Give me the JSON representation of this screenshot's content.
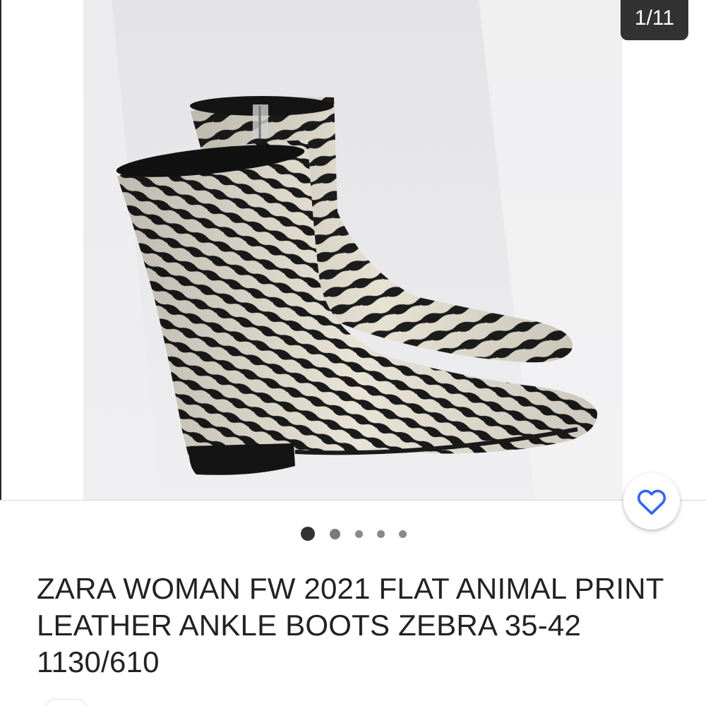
{
  "gallery": {
    "counter": "1/11",
    "total_images": 11,
    "current_index": 1,
    "image_alt": "Zebra print flat ankle boots",
    "dots_count": 5,
    "active_dot": 0
  },
  "actions": {
    "favorite_icon": "heart-outline-icon",
    "favorite_color": "#3665f3"
  },
  "listing": {
    "title": "ZARA WOMAN FW 2021 FLAT ANIMAL PRINT LEATHER ANKLE BOOTS ZEBRA 35-42 1130/610"
  },
  "colors": {
    "badge_bg": "#323232",
    "badge_text": "#ffffff",
    "title_text": "#222222",
    "active_dot": "#333333",
    "inactive_dot": "#8a8a8a"
  }
}
